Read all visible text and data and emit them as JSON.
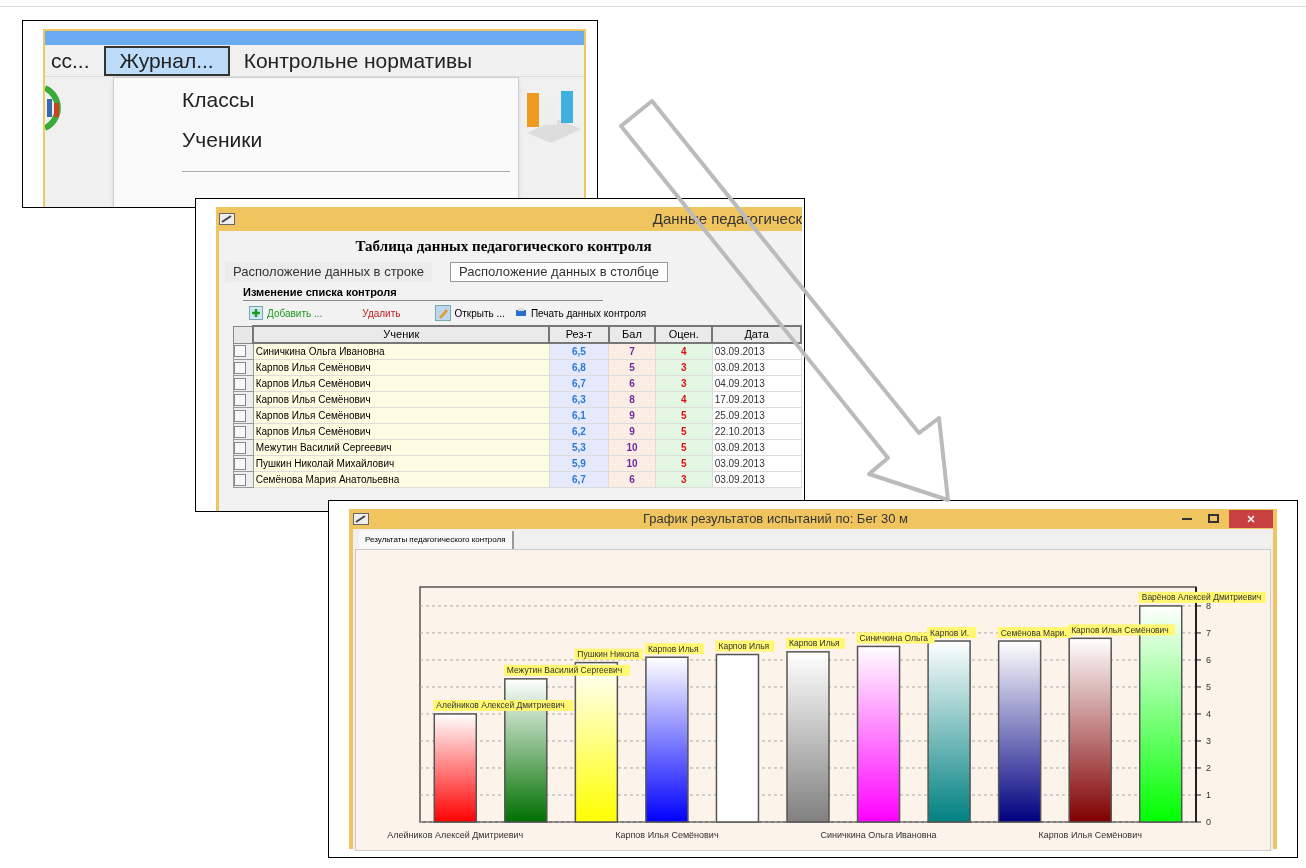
{
  "menu_window": {
    "menu": [
      {
        "label": "сс...",
        "selected": false
      },
      {
        "label": "Журнал...",
        "selected": true
      },
      {
        "label": "Контрольне нормативы",
        "selected": false
      }
    ],
    "dropdown": [
      "Классы",
      "Ученики"
    ]
  },
  "data_window": {
    "title": "Данные педагогическ",
    "heading": "Таблица данных педагогического контроля",
    "tabs": [
      {
        "label": "Расположение данных в строке",
        "selected": false
      },
      {
        "label": "Расположение данных в столбце",
        "selected": true
      }
    ],
    "group_title": "Изменение списка контроля",
    "toolbar": [
      {
        "label": "Добавить ...",
        "kind": "add"
      },
      {
        "label": "Удалить",
        "kind": "delete"
      },
      {
        "label": "Открыть ...",
        "kind": "open"
      },
      {
        "label": "Печать данных контроля",
        "kind": "print"
      }
    ],
    "table": {
      "columns": [
        "Ученик",
        "Рез-т",
        "Бал",
        "Оцен.",
        "Дата"
      ],
      "rows": [
        [
          "Синичкина Ольга Ивановна",
          "6,5",
          "7",
          "4",
          "03.09.2013"
        ],
        [
          "Карпов Илья Семёнович",
          "6,8",
          "5",
          "3",
          "03.09.2013"
        ],
        [
          "Карпов Илья Семёнович",
          "6,7",
          "6",
          "3",
          "04.09.2013"
        ],
        [
          "Карпов Илья Семёнович",
          "6,3",
          "8",
          "4",
          "17.09.2013"
        ],
        [
          "Карпов Илья Семёнович",
          "6,1",
          "9",
          "5",
          "25.09.2013"
        ],
        [
          "Карпов Илья Семёнович",
          "6,2",
          "9",
          "5",
          "22.10.2013"
        ],
        [
          "Межутин Василий Сергеевич",
          "5,3",
          "10",
          "5",
          "03.09.2013"
        ],
        [
          "Пушкин Николай Михайлович",
          "5,9",
          "10",
          "5",
          "03.09.2013"
        ],
        [
          "Семёнова Мария Анатольевна",
          "6,7",
          "6",
          "3",
          "03.09.2013"
        ]
      ]
    }
  },
  "chart_window": {
    "title": "График результатов испытаний по: Бег 30 м",
    "tabs": [
      {
        "label": "Результаты педагогического контроля",
        "selected": true
      }
    ],
    "chart_data": {
      "type": "bar",
      "grid": true,
      "categories": [
        "Алейников Алексей Дмитриевич",
        null,
        null,
        "Карпов Илья Семёнович",
        null,
        null,
        "Синичкина Ольга Ивановна",
        null,
        null,
        "Карпов Илья Семёнович",
        null
      ],
      "annotations": [
        {
          "text": "Алейников Алексей Дмитриевич"
        },
        {
          "text": "Межутин Василий Сергеевич"
        },
        {
          "text": "Пушкин Никола"
        },
        {
          "text": "Карпов Илья"
        },
        {
          "text": "Карпов Илья"
        },
        {
          "text": "Карпов Илья"
        },
        {
          "text": "Синичкина Ольга"
        },
        {
          "text": "Карпов И."
        },
        {
          "text": "Семёнова Мари."
        },
        {
          "text": "Карпов Илья Семёнович"
        },
        {
          "text": "Варёнов Алексей Дмитриевич"
        }
      ],
      "series": [
        {
          "values": [
            4.0,
            5.3,
            5.9,
            6.1,
            6.2,
            6.3,
            6.5,
            6.7,
            6.7,
            6.8,
            8.0
          ]
        }
      ],
      "colors": [
        "#ff0000",
        "#007000",
        "#ffff00",
        "#0000ff",
        "#ffffff",
        "#808080",
        "#ff00ff",
        "#008080",
        "#000080",
        "#800000",
        "#00ff00"
      ],
      "ylim": [
        0,
        8.7
      ],
      "yticks": [
        0,
        1,
        2,
        3,
        4,
        5,
        6,
        7,
        8
      ]
    }
  }
}
